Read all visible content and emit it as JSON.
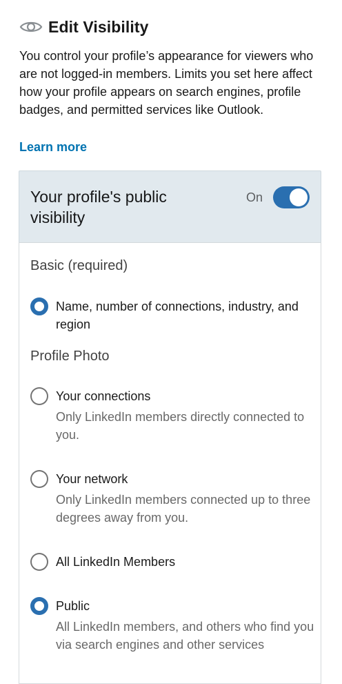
{
  "header": {
    "icon": "eye-icon",
    "title": "Edit Visibility"
  },
  "intro": {
    "text": "You control your profile’s appearance for viewers who are not logged-in members. Limits you set here affect how your profile appears on search engines, profile badges, and permitted services like Outlook.",
    "learn_more": "Learn more"
  },
  "public_visibility": {
    "title": "Your profile's public visibility",
    "toggle_state": "On",
    "enabled": true
  },
  "basic": {
    "label": "Basic (required)",
    "option": {
      "label": "Name, number of connections, industry, and region",
      "checked": true
    }
  },
  "profile_photo": {
    "label": "Profile Photo",
    "options": [
      {
        "label": "Your connections",
        "description": "Only LinkedIn members directly connected to you.",
        "checked": false
      },
      {
        "label": "Your network",
        "description": "Only LinkedIn members connected up to three degrees away from you.",
        "checked": false
      },
      {
        "label": "All LinkedIn Members",
        "description": "",
        "checked": false
      },
      {
        "label": "Public",
        "description": "All LinkedIn members, and others who find you via search engines and other services",
        "checked": true
      }
    ]
  },
  "colors": {
    "accent": "#2a6fb0",
    "link": "#0073b1",
    "card_header_bg": "#e1e9ee"
  }
}
